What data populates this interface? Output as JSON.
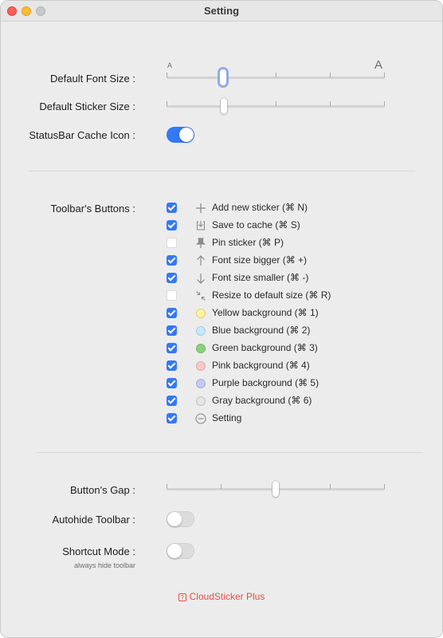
{
  "window": {
    "title": "Setting"
  },
  "font_size": {
    "label": "Default Font Size :",
    "small_glyph": "A",
    "large_glyph": "A",
    "value_fraction": 0.25,
    "ticks": 5
  },
  "sticker_size": {
    "label": "Default Sticker Size :",
    "value_fraction": 0.255,
    "ticks": 5
  },
  "statusbar_icon": {
    "label": "StatusBar Cache Icon :",
    "on": true
  },
  "toolbar_buttons": {
    "label": "Toolbar's Buttons :",
    "items": [
      {
        "label": "Add new sticker (⌘ N)",
        "checked": true,
        "icon": "plus-icon"
      },
      {
        "label": "Save to cache (⌘ S)",
        "checked": true,
        "icon": "download-tray-icon"
      },
      {
        "label": "Pin sticker (⌘ P)",
        "checked": false,
        "icon": "pin-icon"
      },
      {
        "label": "Font size bigger (⌘ +)",
        "checked": true,
        "icon": "arrow-up-icon"
      },
      {
        "label": "Font size smaller (⌘ -)",
        "checked": true,
        "icon": "arrow-down-icon"
      },
      {
        "label": "Resize to default size (⌘ R)",
        "checked": false,
        "icon": "shrink-arrows-icon"
      },
      {
        "label": "Yellow background (⌘ 1)",
        "checked": true,
        "color": "#fdf3a1",
        "border": "#e0d27a"
      },
      {
        "label": "Blue background (⌘ 2)",
        "checked": true,
        "color": "#c7e7f8",
        "border": "#a6cde2"
      },
      {
        "label": "Green background (⌘ 3)",
        "checked": true,
        "color": "#8bd07f",
        "border": "#74b868"
      },
      {
        "label": "Pink background (⌘ 4)",
        "checked": true,
        "color": "#f6c9cc",
        "border": "#deaaae"
      },
      {
        "label": "Purple background (⌘ 5)",
        "checked": true,
        "color": "#c4caf4",
        "border": "#a7aedc"
      },
      {
        "label": "Gray background (⌘ 6)",
        "checked": true,
        "color": "#e4e4e4",
        "border": "#c2c2c2"
      },
      {
        "label": "Setting",
        "checked": true,
        "icon": "circle-minus-icon"
      }
    ]
  },
  "button_gap": {
    "label": "Button's Gap :",
    "value_fraction": 0.5,
    "ticks": 5
  },
  "autohide_toolbar": {
    "label": "Autohide Toolbar :",
    "on": false
  },
  "shortcut_mode": {
    "label": "Shortcut Mode :",
    "sublabel": "always hide toolbar",
    "on": false
  },
  "plus_link": {
    "label": "CloudSticker Plus",
    "badge": "?",
    "color": "#e05146"
  },
  "accent": "#3478f6"
}
